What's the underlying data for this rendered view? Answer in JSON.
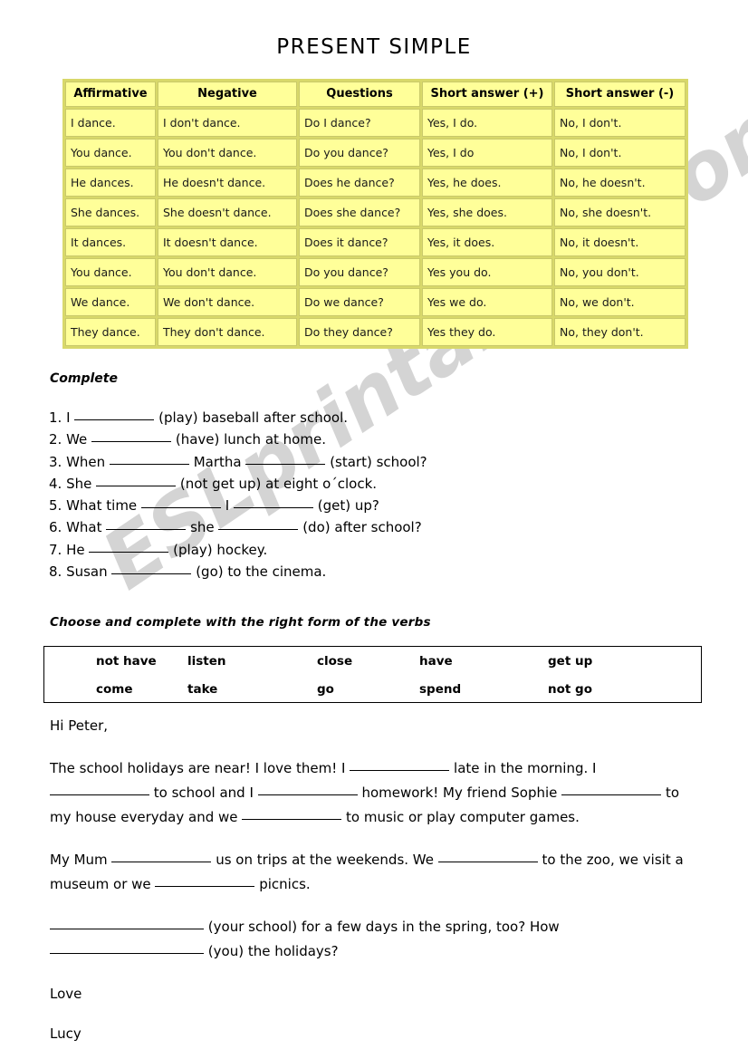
{
  "document": {
    "title": "PRESENT SIMPLE",
    "watermark": "ESLprintables.com"
  },
  "conjugation_table": {
    "name": "present-simple-conjugation-table",
    "headers": [
      "Affirmative",
      "Negative",
      "Questions",
      "Short answer (+)",
      "Short answer (-)"
    ],
    "rows": [
      [
        "I dance.",
        "I don't dance.",
        "Do I dance?",
        "Yes, I do.",
        "No, I don't."
      ],
      [
        "You dance.",
        "You don't dance.",
        "Do you dance?",
        "Yes, I do",
        "No, I don't."
      ],
      [
        "He dances.",
        "He doesn't dance.",
        "Does he dance?",
        "Yes, he does.",
        "No, he doesn't."
      ],
      [
        "She dances.",
        "She doesn't dance.",
        "Does she dance?",
        "Yes, she does.",
        "No, she doesn't."
      ],
      [
        "It dances.",
        "It doesn't dance.",
        "Does it dance?",
        "Yes, it does.",
        "No, it doesn't."
      ],
      [
        "You dance.",
        "You don't dance.",
        "Do you dance?",
        "Yes you do.",
        "No, you don't."
      ],
      [
        "We dance.",
        "We don't dance.",
        "Do we dance?",
        "Yes we do.",
        "No, we don't."
      ],
      [
        "They dance.",
        "They don't dance.",
        "Do they dance?",
        "Yes they do.",
        "No, they don't."
      ]
    ]
  },
  "exercise_complete": {
    "heading": "Complete",
    "items": [
      {
        "number": "1.",
        "before": "I",
        "middle": "",
        "after": "(play) baseball after school.",
        "blanks": 1
      },
      {
        "number": "2.",
        "before": "We",
        "middle": "",
        "after": "(have) lunch at home.",
        "blanks": 1
      },
      {
        "number": "3.",
        "before": "When",
        "middle": "Martha",
        "after": "(start) school?",
        "blanks": 2
      },
      {
        "number": "4.",
        "before": "She",
        "middle": "",
        "after": "(not get up) at eight o´clock.",
        "blanks": 1
      },
      {
        "number": "5.",
        "before": "What time",
        "middle": "I",
        "after": "(get) up?",
        "blanks": 2
      },
      {
        "number": "6.",
        "before": "What",
        "middle": "she",
        "after": "(do) after school?",
        "blanks": 2
      },
      {
        "number": "7.",
        "before": "He",
        "middle": "",
        "after": "(play) hockey.",
        "blanks": 1
      },
      {
        "number": "8.",
        "before": "Susan",
        "middle": "",
        "after": "(go) to the cinema.",
        "blanks": 1
      }
    ]
  },
  "exercise_choose": {
    "heading": "Choose and complete with the right form of the verbs",
    "word_bank": {
      "row1": [
        "not have",
        "listen",
        "close",
        "have",
        "get up"
      ],
      "row2": [
        "come",
        "take",
        "go",
        "spend",
        "not go"
      ]
    }
  },
  "letter": {
    "greeting": "Hi Peter,",
    "para1_a": "The school holidays are near! I love them! I",
    "para1_b": "late in the morning. I",
    "para1_c": "to school and I",
    "para1_d": "homework! My friend Sophie",
    "para1_e": "to my house everyday and we",
    "para1_f": "to music or play computer games.",
    "para2_a": "My Mum",
    "para2_b": "us on trips at the weekends. We",
    "para2_c": "to the zoo, we visit a museum or we",
    "para2_d": "picnics.",
    "para3_a": "(your school) for a few days in the spring, too? How",
    "para3_b": "(you) the holidays?",
    "closing": "Love",
    "signature": "Lucy"
  }
}
